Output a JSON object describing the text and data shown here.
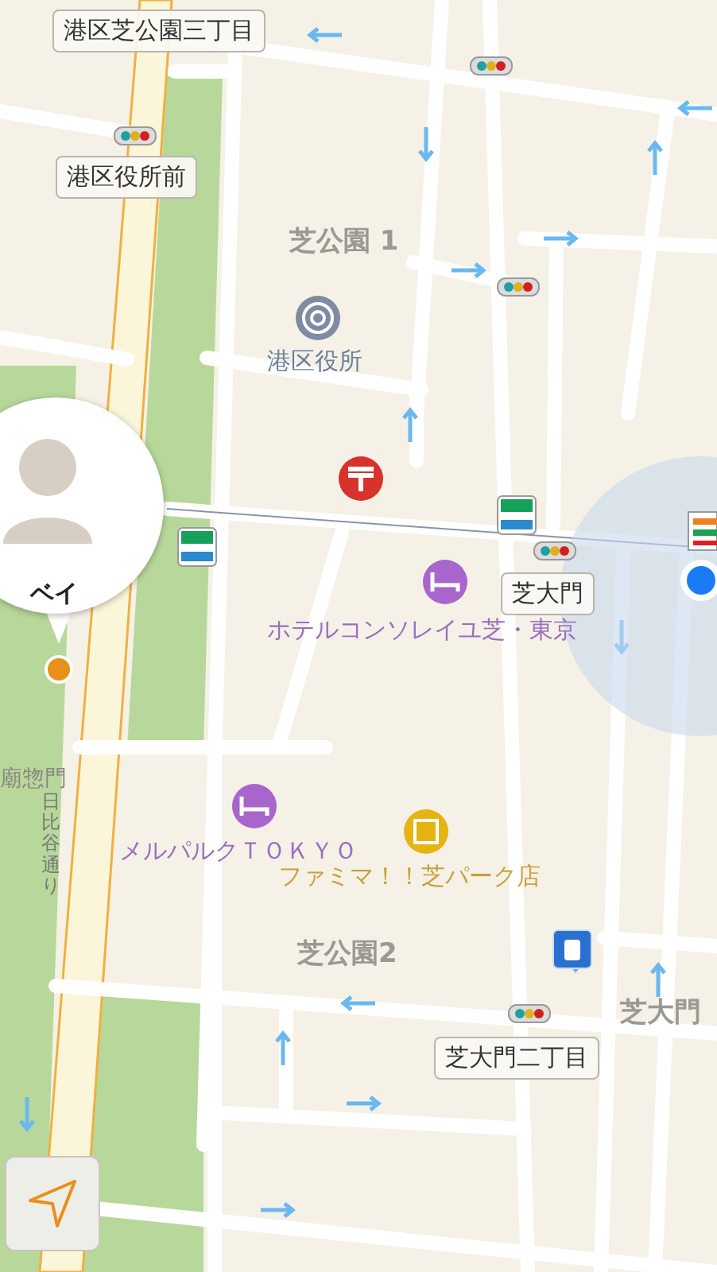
{
  "map": {
    "intersection_labels": [
      "港区芝公園三丁目",
      "港区役所前",
      "芝大門",
      "芝大門二丁目"
    ],
    "area_labels": [
      "芝公園 1",
      "芝公園2",
      "芝大門"
    ],
    "pois": [
      {
        "kind": "government",
        "name": "港区役所"
      },
      {
        "kind": "hotel",
        "name": "ホテルコンソレイユ芝・東京"
      },
      {
        "kind": "hotel",
        "name": "メルパルクＴＯＫＹＯ"
      },
      {
        "kind": "store",
        "name": "ファミマ！！芝パーク店"
      }
    ],
    "place_labels": [
      "廟惣門"
    ],
    "road_labels": [
      "日比谷通り"
    ],
    "friend_pin": {
      "name": "ベイ"
    }
  }
}
